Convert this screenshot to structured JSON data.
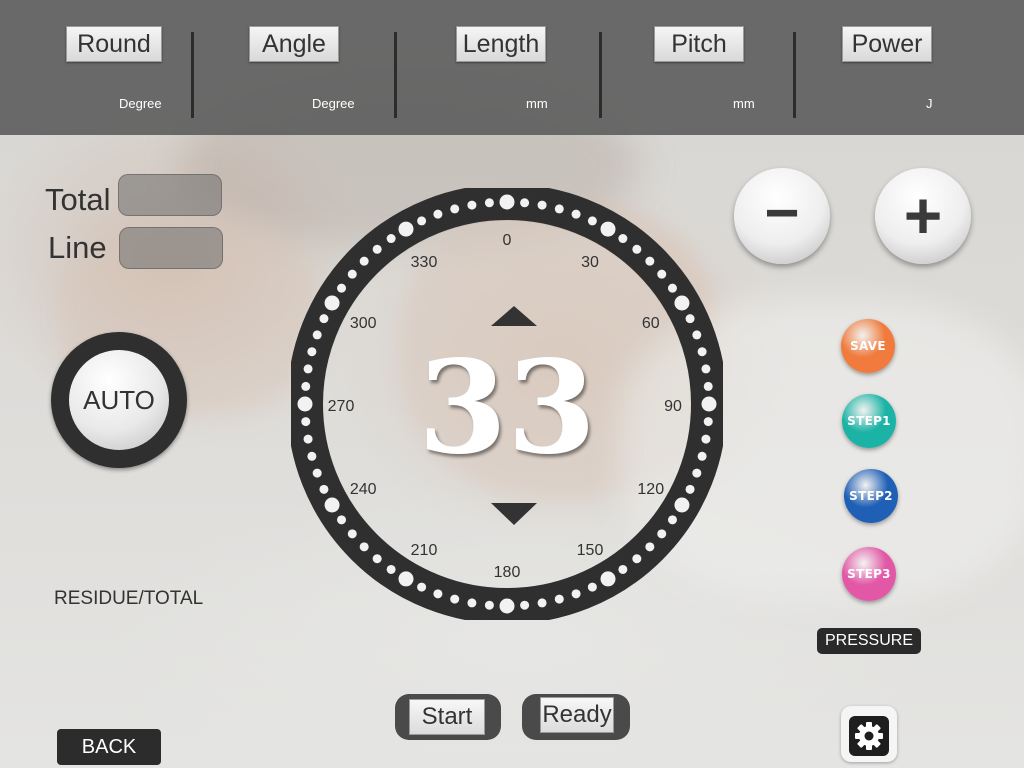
{
  "params": [
    {
      "label": "Round",
      "unit": "Degree"
    },
    {
      "label": "Angle",
      "unit": "Degree"
    },
    {
      "label": "Length",
      "unit": "mm"
    },
    {
      "label": "Pitch",
      "unit": "mm"
    },
    {
      "label": "Power",
      "unit": "J"
    }
  ],
  "counters": {
    "total_label": "Total",
    "line_label": "Line",
    "total_value": "",
    "line_value": ""
  },
  "auto_label": "AUTO",
  "residue_label": "RESIDUE/TOTAL",
  "dial": {
    "value": "33",
    "tick_labels": [
      "0",
      "30",
      "60",
      "90",
      "120",
      "150",
      "180",
      "210",
      "240",
      "270",
      "300",
      "330"
    ]
  },
  "minus_label": "−",
  "plus_label": "+",
  "steps": {
    "save": {
      "label": "SAVE",
      "color": "#f07b3c"
    },
    "step1": {
      "label": "STEP1",
      "color": "#1bb3a6"
    },
    "step2": {
      "label": "STEP2",
      "color": "#1f5fb5"
    },
    "step3": {
      "label": "STEP3",
      "color": "#e257a6"
    }
  },
  "pressure_label": "PRESSURE",
  "start_label": "Start",
  "ready_label": "Ready",
  "back_label": "BACK",
  "colors": {
    "topbar": "#5f5f5f",
    "dial_ring": "#2f2f2f"
  }
}
